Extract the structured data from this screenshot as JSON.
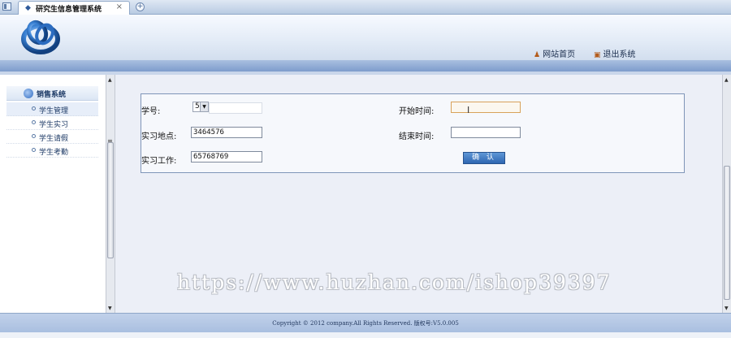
{
  "tab": {
    "title": "研究生信息管理系统",
    "close": "×",
    "new": "+"
  },
  "header": {
    "links": [
      {
        "label": "网站首页",
        "icon": "person-icon"
      },
      {
        "label": "退出系统",
        "icon": "exit-icon"
      }
    ]
  },
  "sidebar": {
    "section_title": "销售系统",
    "items": [
      {
        "label": "学生管理"
      },
      {
        "label": "学生实习"
      },
      {
        "label": "学生请假"
      },
      {
        "label": "学生考勤"
      }
    ]
  },
  "form": {
    "student_no_label": "学号:",
    "student_no_value": "5",
    "start_time_label": "开始时间:",
    "start_time_value": "",
    "location_label": "实习地点:",
    "location_value": "3464576",
    "end_time_label": "结束时间:",
    "end_time_value": "",
    "work_label": "实习工作:",
    "work_value": "65768769",
    "confirm_label": "确 认"
  },
  "watermark": "https://www.huzhan.com/ishop39397",
  "footer": {
    "text": "Copyright © 2012 company.All Rights Reserved. 版权号:V5.0.005"
  },
  "colors": {
    "accent": "#2e66b1",
    "header_bar": "#7d9ccc",
    "focus_border": "#d8a25a"
  }
}
